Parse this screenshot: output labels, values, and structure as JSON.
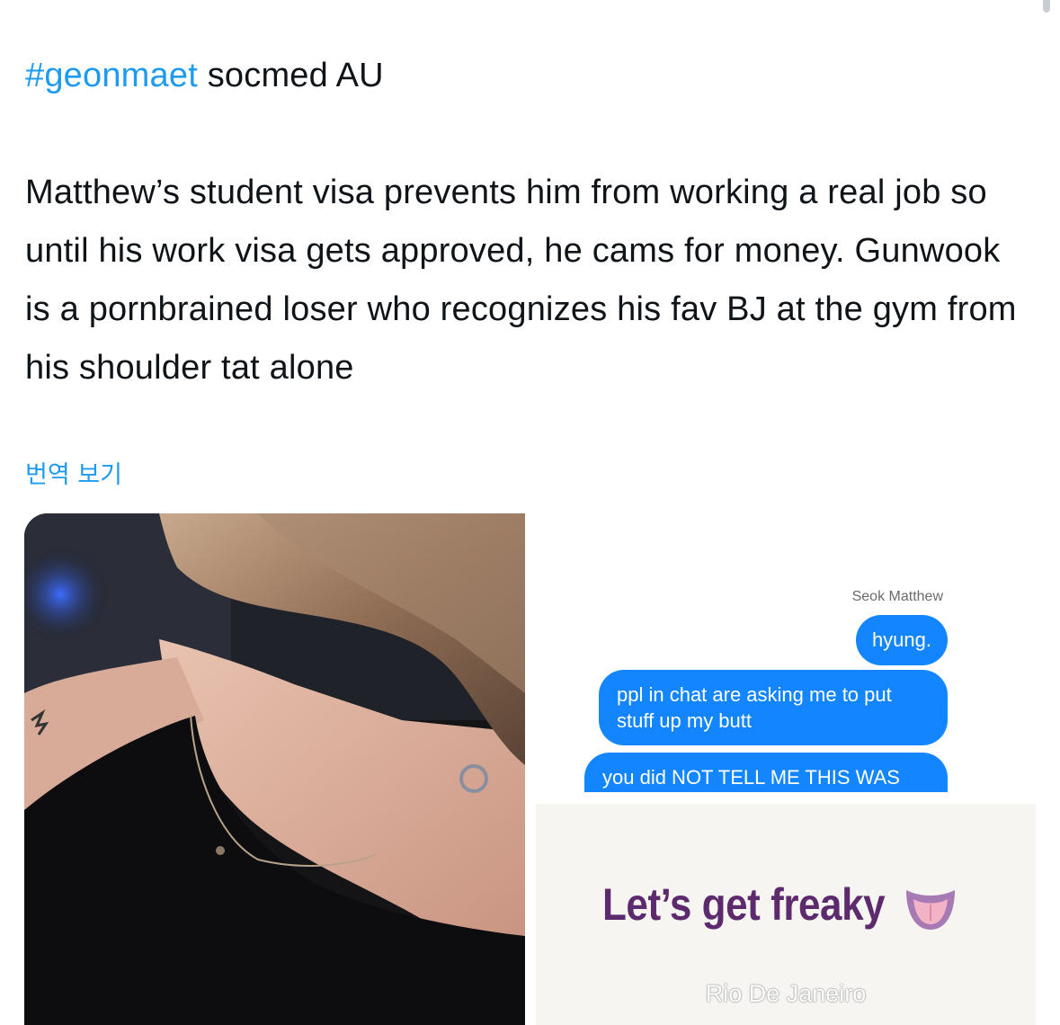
{
  "tweet": {
    "hashtag": "#geonmaet",
    "title_rest": "socmed AU",
    "body": "Matthew’s student visa prevents him from working a real job so until his work visa gets approved, he cams for money. Gunwook is a pornbrained loser who recognizes his fav BJ at the gym from his shoulder tat alone",
    "translate_link": "번역 보기"
  },
  "media": {
    "chat": {
      "contact_name": "Seok Matthew",
      "messages": [
        "hyung.",
        "ppl in chat are asking me to put stuff up my butt",
        "you did NOT TELL ME THIS WAS"
      ]
    },
    "story": {
      "caption": "Let’s get freaky",
      "emoji": "tongue-face-emoji",
      "location": "Rio De Janeiro"
    },
    "photo": {
      "subject": "shoulder-tattoo-photo"
    }
  },
  "colors": {
    "link": "#1d9bf0",
    "bubble": "#1386ff",
    "caption": "#5d2a6e"
  }
}
